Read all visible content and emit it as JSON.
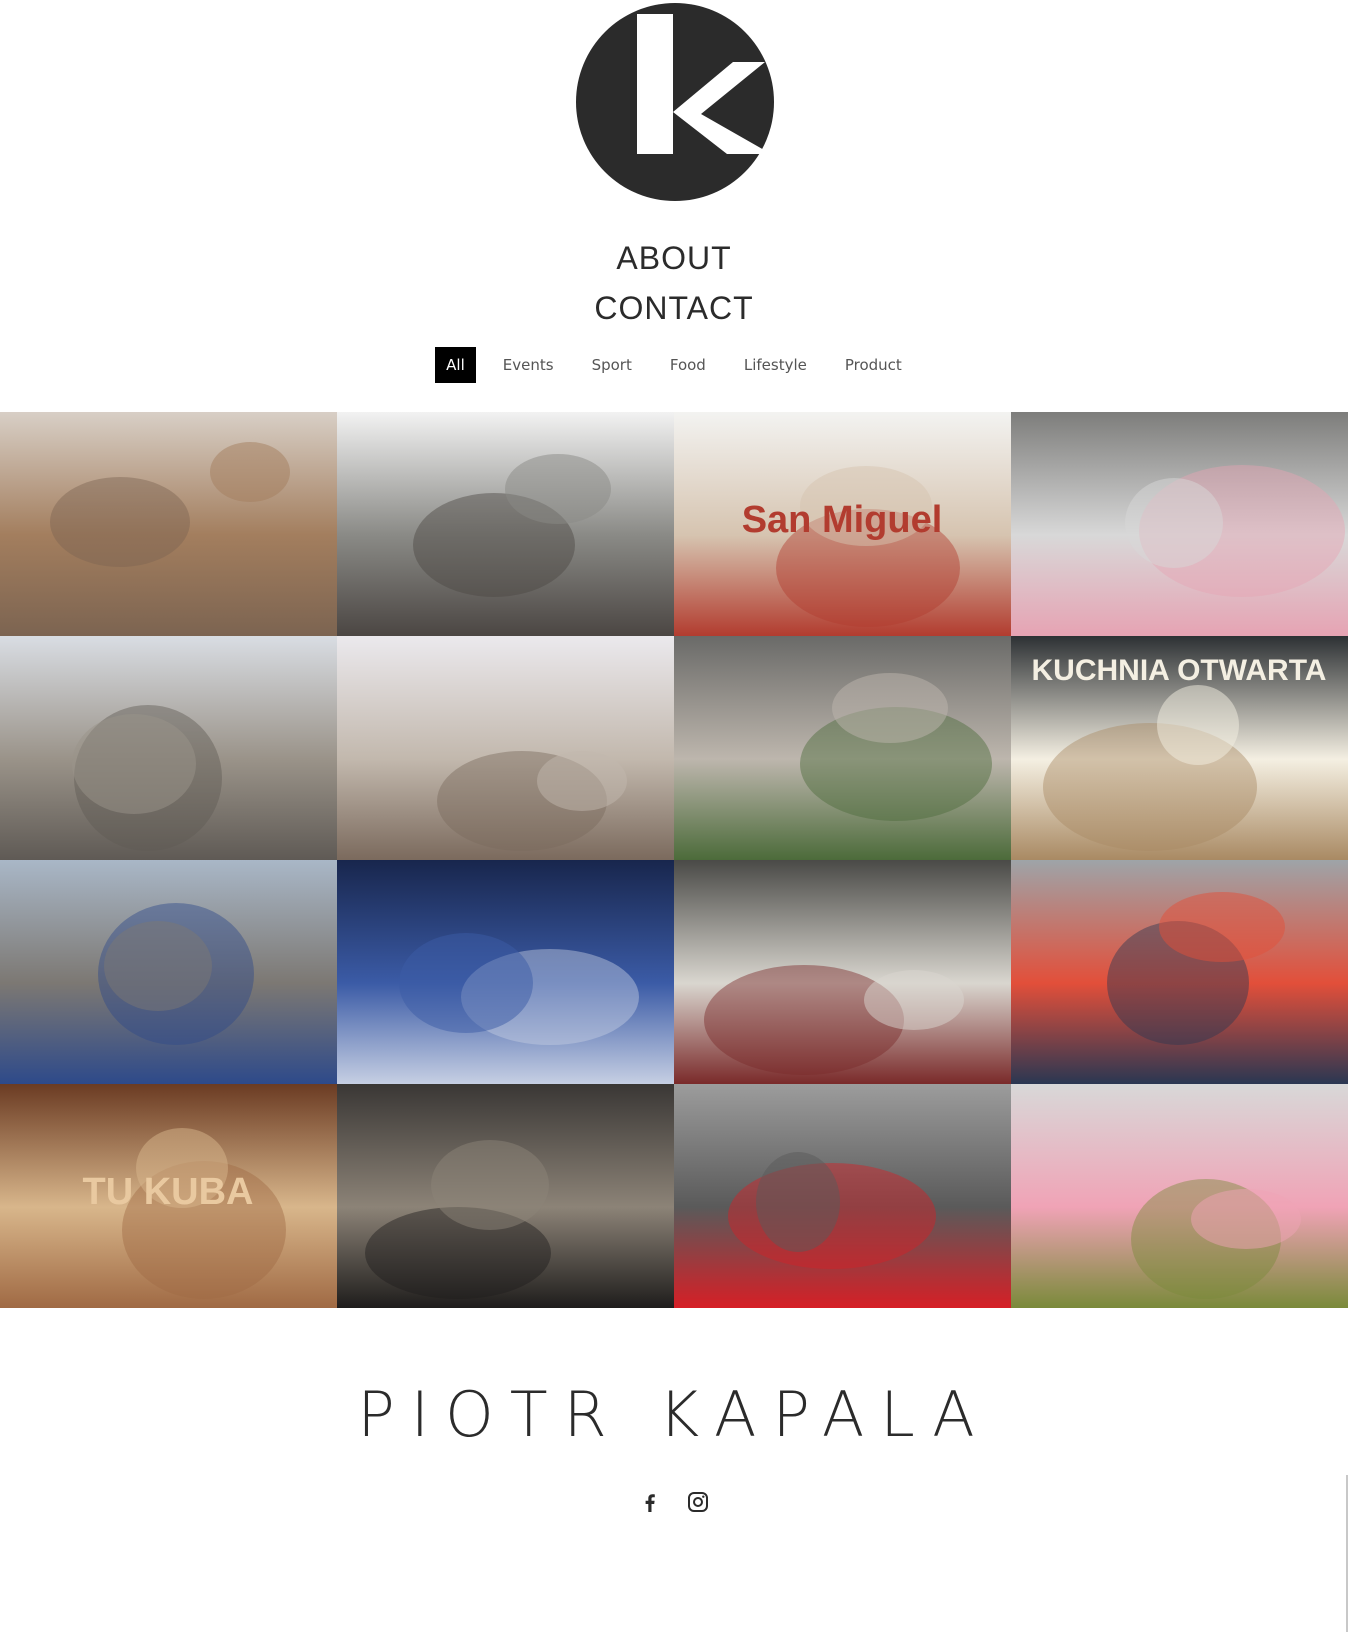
{
  "brand": {
    "logo_icon": "k-circle-logo-icon",
    "logo_color": "#2b2b2b"
  },
  "menu": {
    "about": "ABOUT",
    "contact": "CONTACT"
  },
  "filters": [
    {
      "label": "All",
      "active": true
    },
    {
      "label": "Events",
      "active": false
    },
    {
      "label": "Sport",
      "active": false
    },
    {
      "label": "Food",
      "active": false
    },
    {
      "label": "Lifestyle",
      "active": false
    },
    {
      "label": "Product",
      "active": false
    }
  ],
  "gallery": [
    {
      "subject": "weimaraner-dog-with-flowers",
      "sign_text": "",
      "palette": [
        "#d8cfc6",
        "#a37e5e",
        "#7c6451"
      ]
    },
    {
      "subject": "fashion-event-photographers",
      "sign_text": "",
      "palette": [
        "#f2f2f2",
        "#8a8a86",
        "#4b4643"
      ]
    },
    {
      "subject": "san-miguel-beach-stand",
      "sign_text": "San Miguel",
      "palette": [
        "#f3f3f1",
        "#d6c4b0",
        "#b23c2f"
      ]
    },
    {
      "subject": "woman-sunglasses-lying-top-view",
      "sign_text": "",
      "palette": [
        "#7d7d7b",
        "#d8d8d8",
        "#e6a3b3"
      ]
    },
    {
      "subject": "offroad-quarry-landscape",
      "sign_text": "",
      "palette": [
        "#d9dde3",
        "#9a9389",
        "#5f5a55"
      ]
    },
    {
      "subject": "breakfast-window-still-life",
      "sign_text": "",
      "palette": [
        "#ebe9ed",
        "#c2b8ad",
        "#7b6a5d"
      ]
    },
    {
      "subject": "restaurant-interior-plants",
      "sign_text": "",
      "palette": [
        "#6a6a68",
        "#bdb6ad",
        "#4c6b3a"
      ]
    },
    {
      "subject": "kuchnia-otwarta-neon-table",
      "sign_text": "KUCHNIA OTWARTA",
      "palette": [
        "#2d3134",
        "#f4efe2",
        "#a98a63"
      ]
    },
    {
      "subject": "motocross-riders-pushing-bike",
      "sign_text": "",
      "palette": [
        "#a9b7c7",
        "#7c7873",
        "#2e4a8a"
      ]
    },
    {
      "subject": "woman-in-pool-night",
      "sign_text": "",
      "palette": [
        "#18264d",
        "#3b5ba6",
        "#c6cfe3"
      ]
    },
    {
      "subject": "wine-and-sushi-table",
      "sign_text": "",
      "palette": [
        "#4a4a47",
        "#d9d6cf",
        "#7a2a2a"
      ]
    },
    {
      "subject": "redbull-motocross-start",
      "sign_text": "",
      "palette": [
        "#9ea4a8",
        "#e24f3a",
        "#2a3752"
      ]
    },
    {
      "subject": "tu-kuba-bread-board",
      "sign_text": "TU KUBA",
      "palette": [
        "#6b3b23",
        "#d8b68b",
        "#a06a44"
      ]
    },
    {
      "subject": "rustic-wooden-interior",
      "sign_text": "",
      "palette": [
        "#3a3735",
        "#8c8377",
        "#1f1d1c"
      ]
    },
    {
      "subject": "red-ferrari-street-crowd",
      "sign_text": "",
      "palette": [
        "#9c9c9c",
        "#5a5a5a",
        "#d61f26"
      ]
    },
    {
      "subject": "woman-flower-wreath-top-view",
      "sign_text": "",
      "palette": [
        "#d8d8d8",
        "#f0a3b6",
        "#7a8a3a"
      ]
    }
  ],
  "footer": {
    "name": "PIOTR KAPALA",
    "social": [
      {
        "icon": "facebook-icon"
      },
      {
        "icon": "instagram-icon"
      }
    ]
  }
}
